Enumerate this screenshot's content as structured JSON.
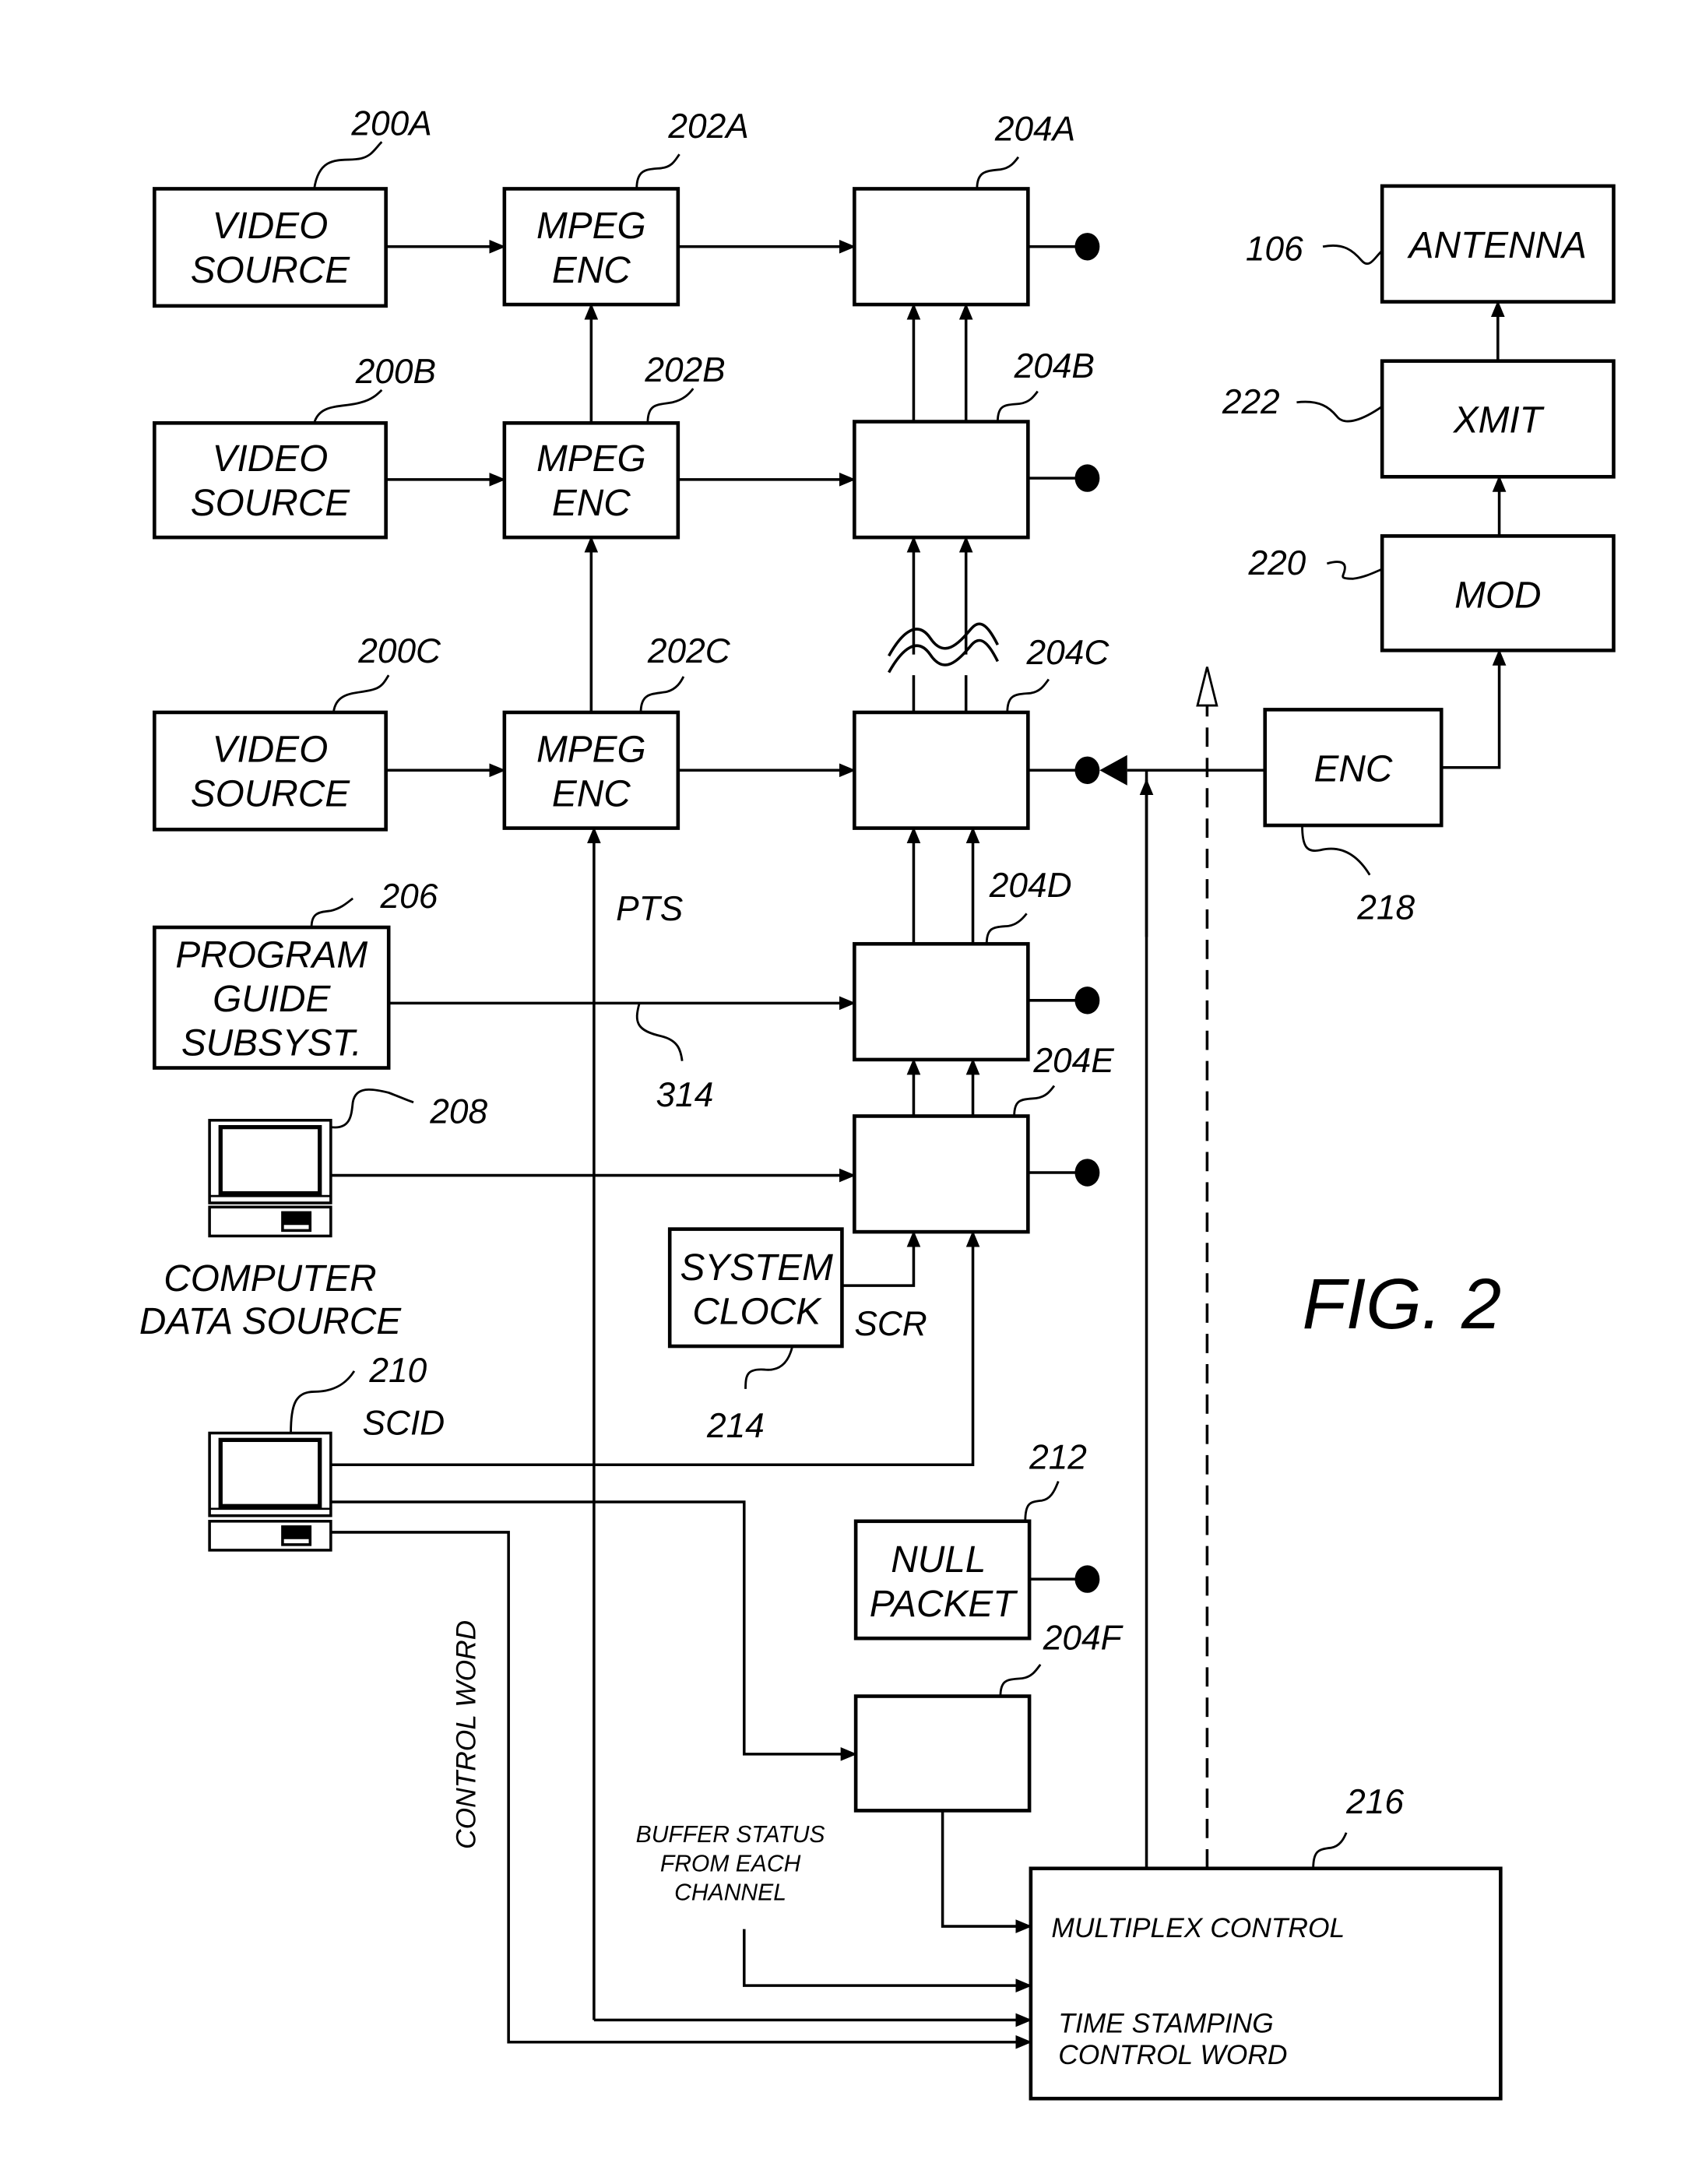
{
  "figure": {
    "title": "FIG. 2",
    "blocks": {
      "video_source_a": {
        "ref": "200A",
        "lines": [
          "VIDEO",
          "SOURCE"
        ]
      },
      "video_source_b": {
        "ref": "200B",
        "lines": [
          "VIDEO",
          "SOURCE"
        ]
      },
      "video_source_c": {
        "ref": "200C",
        "lines": [
          "VIDEO",
          "SOURCE"
        ]
      },
      "mpeg_enc_a": {
        "ref": "202A",
        "lines": [
          "MPEG",
          "ENC"
        ]
      },
      "mpeg_enc_b": {
        "ref": "202B",
        "lines": [
          "MPEG",
          "ENC"
        ]
      },
      "mpeg_enc_c": {
        "ref": "202C",
        "lines": [
          "MPEG",
          "ENC"
        ]
      },
      "buffer_a": {
        "ref": "204A"
      },
      "buffer_b": {
        "ref": "204B"
      },
      "buffer_c": {
        "ref": "204C"
      },
      "buffer_d": {
        "ref": "204D"
      },
      "buffer_e": {
        "ref": "204E"
      },
      "buffer_f": {
        "ref": "204F"
      },
      "program_guide": {
        "ref": "206",
        "lines": [
          "PROGRAM",
          "GUIDE",
          "SUBSYST."
        ]
      },
      "computer_data_source": {
        "ref": "208",
        "lines": [
          "COMPUTER",
          "DATA SOURCE"
        ]
      },
      "scid_computer": {
        "ref": "210",
        "signal": "SCID"
      },
      "null_packet": {
        "ref": "212",
        "lines": [
          "NULL",
          "PACKET"
        ]
      },
      "system_clock": {
        "ref": "214",
        "lines": [
          "SYSTEM",
          "CLOCK"
        ],
        "signal": "SCR"
      },
      "multiplex_control": {
        "ref": "216",
        "lines": [
          "MULTIPLEX CONTROL",
          "TIME STAMPING",
          "CONTROL WORD"
        ]
      },
      "enc": {
        "ref": "218",
        "lines": [
          "ENC"
        ]
      },
      "mod": {
        "ref": "220",
        "lines": [
          "MOD"
        ]
      },
      "xmit": {
        "ref": "222",
        "lines": [
          "XMIT"
        ]
      },
      "antenna": {
        "ref": "106",
        "lines": [
          "ANTENNA"
        ]
      }
    },
    "signals": {
      "pts": "PTS",
      "program_guide_line": "314",
      "control_word": "CONTROL WORD",
      "buffer_status": [
        "BUFFER STATUS",
        "FROM EACH",
        "CHANNEL"
      ]
    }
  }
}
